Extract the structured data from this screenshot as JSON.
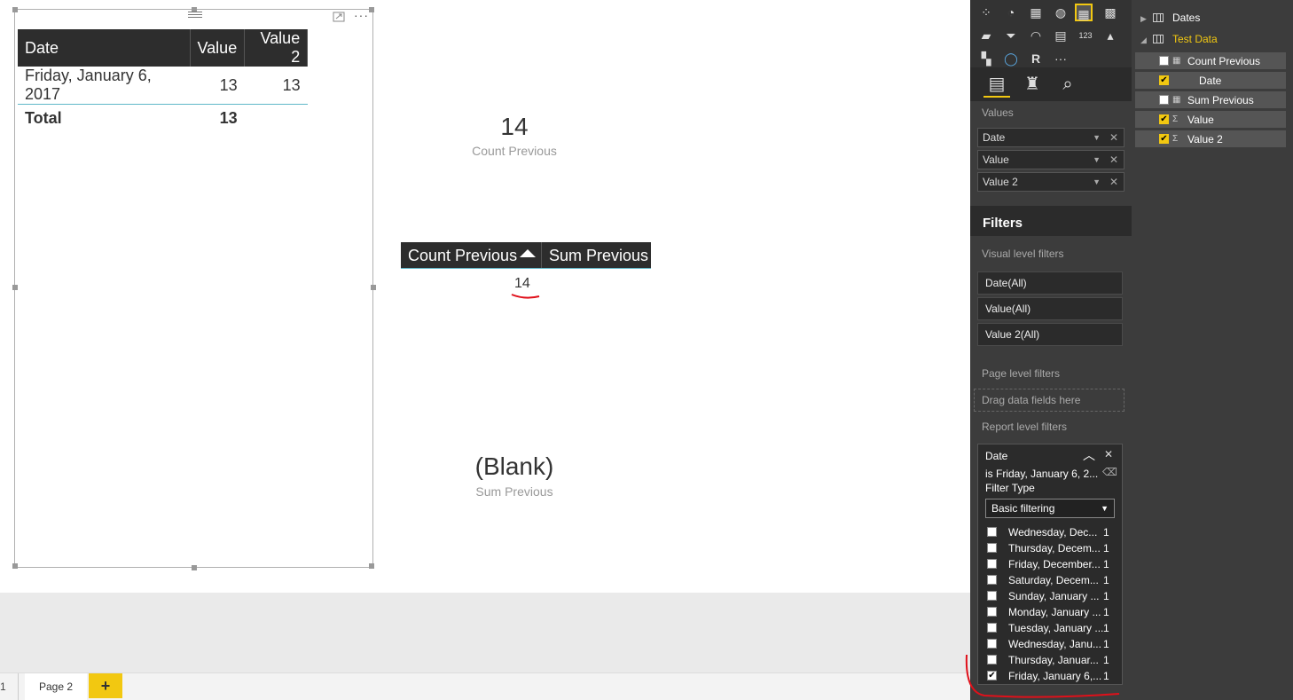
{
  "table_visual": {
    "headers": [
      "Date",
      "Value",
      "Value 2"
    ],
    "row": {
      "date": "Friday, January 6, 2017",
      "value": "13",
      "value2": "13"
    },
    "total": {
      "label": "Total",
      "value": "13"
    },
    "more_label": "···"
  },
  "card_count": {
    "value": "14",
    "label": "Count Previous"
  },
  "matrix": {
    "col1": "Count Previous",
    "col2": "Sum Previous",
    "value": "14"
  },
  "card_sum": {
    "value": "(Blank)",
    "label": "Sum Previous"
  },
  "page_tabs": {
    "prev": "1",
    "active": "Page 2",
    "add": "+"
  },
  "viz_pane": {
    "values_label": "Values",
    "wells": [
      "Date",
      "Value",
      "Value 2"
    ],
    "filters_title": "Filters",
    "visual_level_label": "Visual level filters",
    "visual_filters": [
      "Date(All)",
      "Value(All)",
      "Value 2(All)"
    ],
    "page_level_label": "Page level filters",
    "dropzone_text": "Drag data fields here",
    "report_level_label": "Report level filters",
    "report_filter": {
      "field": "Date",
      "condition": "is Friday, January 6, 2...",
      "type_label": "Filter Type",
      "type_value": "Basic filtering",
      "items": [
        {
          "label": "Wednesday, Dec...",
          "count": "1",
          "checked": false
        },
        {
          "label": "Thursday, Decem...",
          "count": "1",
          "checked": false
        },
        {
          "label": "Friday, December...",
          "count": "1",
          "checked": false
        },
        {
          "label": "Saturday, Decem...",
          "count": "1",
          "checked": false
        },
        {
          "label": "Sunday, January ...",
          "count": "1",
          "checked": false
        },
        {
          "label": "Monday, January ...",
          "count": "1",
          "checked": false
        },
        {
          "label": "Tuesday, January ...",
          "count": "1",
          "checked": false
        },
        {
          "label": "Wednesday, Janu...",
          "count": "1",
          "checked": false
        },
        {
          "label": "Thursday, Januar...",
          "count": "1",
          "checked": false
        },
        {
          "label": "Friday, January 6,...",
          "count": "1",
          "checked": true
        }
      ]
    }
  },
  "fields_pane": {
    "tables": [
      "Dates",
      "Test Data"
    ],
    "fields": [
      {
        "label": "Count Previous",
        "checked": false,
        "icon": "calc-icon"
      },
      {
        "label": "Date",
        "checked": true,
        "icon": ""
      },
      {
        "label": "Sum Previous",
        "checked": false,
        "icon": "calc-icon"
      },
      {
        "label": "Value",
        "checked": true,
        "icon": "sigma-icon"
      },
      {
        "label": "Value 2",
        "checked": true,
        "icon": "sigma-icon"
      }
    ]
  },
  "colors": {
    "accent": "#f2c811",
    "header_bg": "#2d2d2d",
    "pane_bg": "#333333",
    "annotation": "#e0101a",
    "row_line": "#5fb7c9"
  }
}
